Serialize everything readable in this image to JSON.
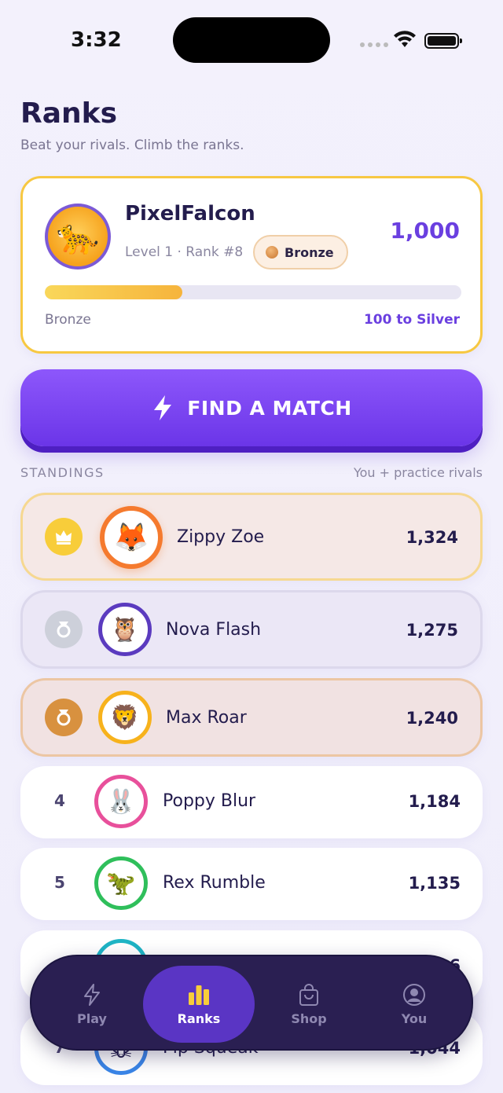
{
  "status": {
    "time": "3:32"
  },
  "header": {
    "title": "Ranks",
    "subtitle": "Beat your rivals. Climb the ranks."
  },
  "profile": {
    "name": "PixelFalcon",
    "level_text": "Level 1 · Rank #8",
    "tier": "Bronze",
    "points": "1,000",
    "progress_fraction": 0.33,
    "progress_left": "Bronze",
    "progress_right": "100 to Silver",
    "avatar_emoji": "🐆"
  },
  "match_button": {
    "label": "FIND A MATCH",
    "icon": "lightning-icon"
  },
  "standings": {
    "label": "STANDINGS",
    "note": "You + practice rivals",
    "rows": [
      {
        "rank": "1",
        "medal": "crown",
        "name": "Zippy Zoe",
        "score": "1,324",
        "emoji": "🦊",
        "ring": "#f57a2e"
      },
      {
        "rank": "2",
        "medal": "silver",
        "name": "Nova Flash",
        "score": "1,275",
        "emoji": "🦉",
        "ring": "#5b3bbf"
      },
      {
        "rank": "3",
        "medal": "bronze",
        "name": "Max Roar",
        "score": "1,240",
        "emoji": "🦁",
        "ring": "#f7b21c"
      },
      {
        "rank": "4",
        "name": "Poppy Blur",
        "score": "1,184",
        "emoji": "🐰",
        "ring": "#e8509b"
      },
      {
        "rank": "5",
        "name": "Rex Rumble",
        "score": "1,135",
        "emoji": "🦖",
        "ring": "#2fbf5b"
      },
      {
        "rank": "6",
        "name": "",
        "score": "1,096",
        "emoji": "",
        "ring": "#1eb4c5"
      },
      {
        "rank": "7",
        "name": "Pip Squeak",
        "score": "1,044",
        "emoji": "🐭",
        "ring": "#3a86e8"
      }
    ]
  },
  "tabs": [
    {
      "label": "Play",
      "icon": "lightning-icon"
    },
    {
      "label": "Ranks",
      "icon": "bar-chart-icon"
    },
    {
      "label": "Shop",
      "icon": "shopping-bag-icon"
    },
    {
      "label": "You",
      "icon": "user-icon"
    }
  ]
}
